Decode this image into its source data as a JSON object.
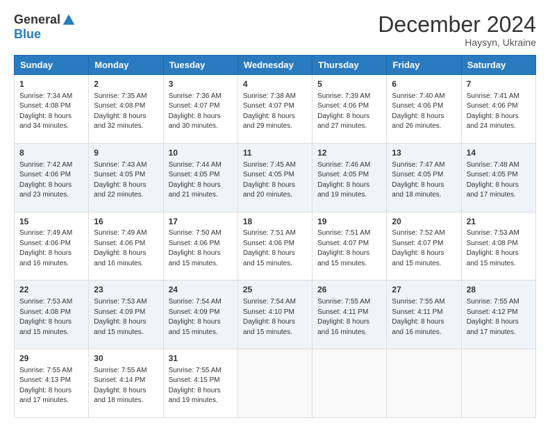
{
  "logo": {
    "general": "General",
    "blue": "Blue"
  },
  "header": {
    "month": "December 2024",
    "location": "Haysyn, Ukraine"
  },
  "weekdays": [
    "Sunday",
    "Monday",
    "Tuesday",
    "Wednesday",
    "Thursday",
    "Friday",
    "Saturday"
  ],
  "weeks": [
    [
      {
        "day": "1",
        "sunrise": "7:34 AM",
        "sunset": "4:08 PM",
        "daylight": "8 hours and 34 minutes."
      },
      {
        "day": "2",
        "sunrise": "7:35 AM",
        "sunset": "4:08 PM",
        "daylight": "8 hours and 32 minutes."
      },
      {
        "day": "3",
        "sunrise": "7:36 AM",
        "sunset": "4:07 PM",
        "daylight": "8 hours and 30 minutes."
      },
      {
        "day": "4",
        "sunrise": "7:38 AM",
        "sunset": "4:07 PM",
        "daylight": "8 hours and 29 minutes."
      },
      {
        "day": "5",
        "sunrise": "7:39 AM",
        "sunset": "4:06 PM",
        "daylight": "8 hours and 27 minutes."
      },
      {
        "day": "6",
        "sunrise": "7:40 AM",
        "sunset": "4:06 PM",
        "daylight": "8 hours and 26 minutes."
      },
      {
        "day": "7",
        "sunrise": "7:41 AM",
        "sunset": "4:06 PM",
        "daylight": "8 hours and 24 minutes."
      }
    ],
    [
      {
        "day": "8",
        "sunrise": "7:42 AM",
        "sunset": "4:06 PM",
        "daylight": "8 hours and 23 minutes."
      },
      {
        "day": "9",
        "sunrise": "7:43 AM",
        "sunset": "4:05 PM",
        "daylight": "8 hours and 22 minutes."
      },
      {
        "day": "10",
        "sunrise": "7:44 AM",
        "sunset": "4:05 PM",
        "daylight": "8 hours and 21 minutes."
      },
      {
        "day": "11",
        "sunrise": "7:45 AM",
        "sunset": "4:05 PM",
        "daylight": "8 hours and 20 minutes."
      },
      {
        "day": "12",
        "sunrise": "7:46 AM",
        "sunset": "4:05 PM",
        "daylight": "8 hours and 19 minutes."
      },
      {
        "day": "13",
        "sunrise": "7:47 AM",
        "sunset": "4:05 PM",
        "daylight": "8 hours and 18 minutes."
      },
      {
        "day": "14",
        "sunrise": "7:48 AM",
        "sunset": "4:05 PM",
        "daylight": "8 hours and 17 minutes."
      }
    ],
    [
      {
        "day": "15",
        "sunrise": "7:49 AM",
        "sunset": "4:06 PM",
        "daylight": "8 hours and 16 minutes."
      },
      {
        "day": "16",
        "sunrise": "7:49 AM",
        "sunset": "4:06 PM",
        "daylight": "8 hours and 16 minutes."
      },
      {
        "day": "17",
        "sunrise": "7:50 AM",
        "sunset": "4:06 PM",
        "daylight": "8 hours and 15 minutes."
      },
      {
        "day": "18",
        "sunrise": "7:51 AM",
        "sunset": "4:06 PM",
        "daylight": "8 hours and 15 minutes."
      },
      {
        "day": "19",
        "sunrise": "7:51 AM",
        "sunset": "4:07 PM",
        "daylight": "8 hours and 15 minutes."
      },
      {
        "day": "20",
        "sunrise": "7:52 AM",
        "sunset": "4:07 PM",
        "daylight": "8 hours and 15 minutes."
      },
      {
        "day": "21",
        "sunrise": "7:53 AM",
        "sunset": "4:08 PM",
        "daylight": "8 hours and 15 minutes."
      }
    ],
    [
      {
        "day": "22",
        "sunrise": "7:53 AM",
        "sunset": "4:08 PM",
        "daylight": "8 hours and 15 minutes."
      },
      {
        "day": "23",
        "sunrise": "7:53 AM",
        "sunset": "4:09 PM",
        "daylight": "8 hours and 15 minutes."
      },
      {
        "day": "24",
        "sunrise": "7:54 AM",
        "sunset": "4:09 PM",
        "daylight": "8 hours and 15 minutes."
      },
      {
        "day": "25",
        "sunrise": "7:54 AM",
        "sunset": "4:10 PM",
        "daylight": "8 hours and 15 minutes."
      },
      {
        "day": "26",
        "sunrise": "7:55 AM",
        "sunset": "4:11 PM",
        "daylight": "8 hours and 16 minutes."
      },
      {
        "day": "27",
        "sunrise": "7:55 AM",
        "sunset": "4:11 PM",
        "daylight": "8 hours and 16 minutes."
      },
      {
        "day": "28",
        "sunrise": "7:55 AM",
        "sunset": "4:12 PM",
        "daylight": "8 hours and 17 minutes."
      }
    ],
    [
      {
        "day": "29",
        "sunrise": "7:55 AM",
        "sunset": "4:13 PM",
        "daylight": "8 hours and 17 minutes."
      },
      {
        "day": "30",
        "sunrise": "7:55 AM",
        "sunset": "4:14 PM",
        "daylight": "8 hours and 18 minutes."
      },
      {
        "day": "31",
        "sunrise": "7:55 AM",
        "sunset": "4:15 PM",
        "daylight": "8 hours and 19 minutes."
      },
      null,
      null,
      null,
      null
    ]
  ],
  "labels": {
    "sunrise": "Sunrise:",
    "sunset": "Sunset:",
    "daylight": "Daylight:"
  }
}
